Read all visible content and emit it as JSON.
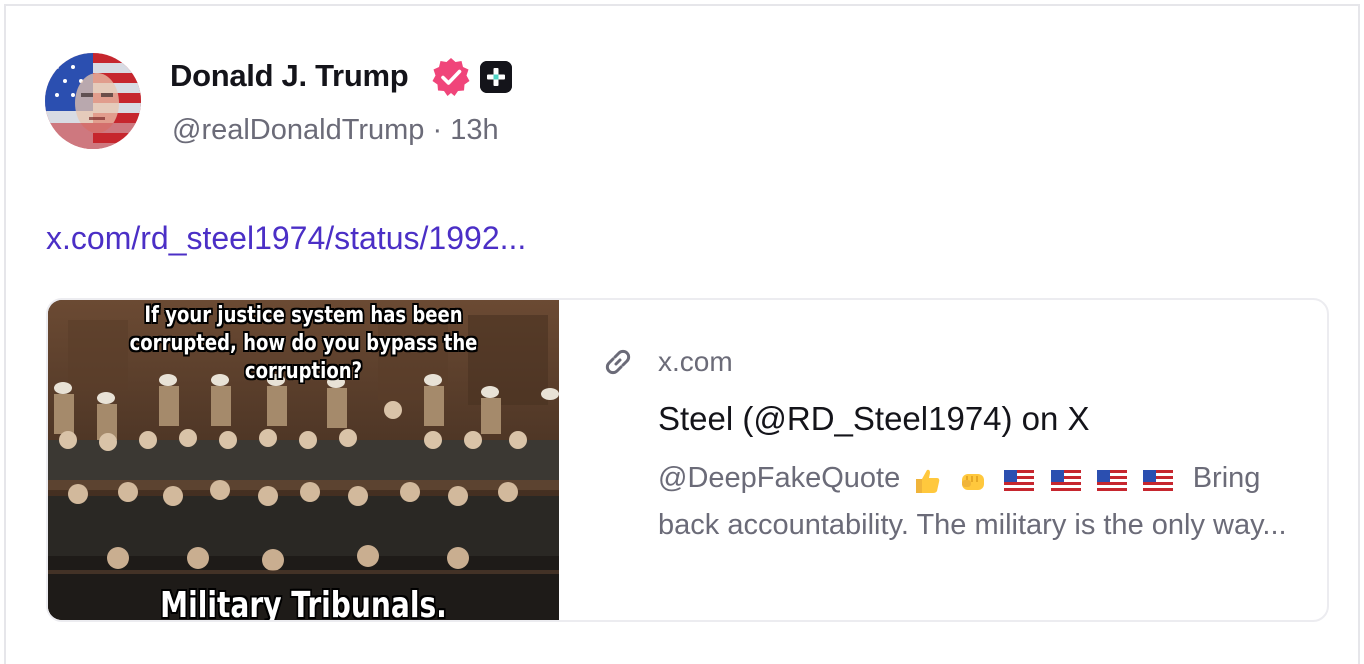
{
  "author": {
    "display_name": "Donald J. Trump",
    "handle": "@realDonaldTrump",
    "separator": "·",
    "timestamp": "13h",
    "avatar_icon": "avatar-image",
    "verified_icon": "verified-badge-icon",
    "badge_icon": "plus-badge-icon"
  },
  "post": {
    "link_text": "x.com/rd_steel1974/status/1992..."
  },
  "card": {
    "image_caption_top": "If your justice system has been corrupted, how do you bypass the corruption?",
    "image_caption_bottom": "Military Tribunals.",
    "link_icon": "link-icon",
    "domain": "x.com",
    "title": "Steel (@RD_Steel1974) on X",
    "desc_prefix": "@DeepFakeQuote",
    "desc_suffix": "Bring back accountability. The military is the only way..."
  },
  "colors": {
    "link": "#4b2fc6",
    "verified": "#f0457a",
    "muted_text": "#6b6b78",
    "primary_text": "#14141a"
  }
}
